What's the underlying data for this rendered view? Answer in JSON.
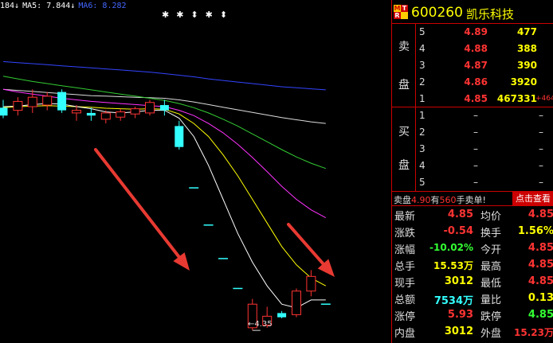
{
  "ma_legend": [
    {
      "text": "184↓",
      "color": "#ffffff"
    },
    {
      "text": "MA5: 7.844↓",
      "color": "#ffffff"
    },
    {
      "text": "MA6: 8.282",
      "color": "#4466ff"
    }
  ],
  "markers": "✱✱⬍✱⬍",
  "low_label": "←4.35",
  "colors": {
    "up": "#ff3333",
    "down": "#33ffff",
    "ma5": "#ffffff",
    "ma10": "#ffff00",
    "ma20": "#ff33ff",
    "ma30": "#33cc33",
    "ma60": "#dddddd",
    "ma120": "#3344ff",
    "border": "#cc0000",
    "highlight": "#ffff00"
  },
  "header": {
    "mtr": [
      "M",
      "T",
      "R"
    ],
    "code": "600260",
    "name": "凯乐科技"
  },
  "sell_side": "卖盘",
  "sell": [
    {
      "level": "5",
      "price": "4.89",
      "vol": "477",
      "chg": ""
    },
    {
      "level": "4",
      "price": "4.88",
      "vol": "388",
      "chg": ""
    },
    {
      "level": "3",
      "price": "4.87",
      "vol": "390",
      "chg": ""
    },
    {
      "level": "2",
      "price": "4.86",
      "vol": "3920",
      "chg": ""
    },
    {
      "level": "1",
      "price": "4.85",
      "vol": "467331",
      "chg": "+464319"
    }
  ],
  "buy_side": "买盘",
  "buy": [
    {
      "level": "1",
      "price": "–",
      "vol": "–"
    },
    {
      "level": "2",
      "price": "–",
      "vol": "–"
    },
    {
      "level": "3",
      "price": "–",
      "vol": "–"
    },
    {
      "level": "4",
      "price": "–",
      "vol": "–"
    },
    {
      "level": "5",
      "price": "–",
      "vol": "–"
    }
  ],
  "tradebar": {
    "prefix": "卖盘",
    "price": "4.90",
    "mid": "有",
    "qty": "560",
    "suffix": "手卖单!",
    "button": "点击查看"
  },
  "stats": [
    {
      "label": "最新",
      "value": "4.85",
      "color": "#ff3333"
    },
    {
      "label": "均价",
      "value": "4.85",
      "color": "#ff3333"
    },
    {
      "label": "涨跌",
      "value": "-0.54",
      "color": "#ff3333"
    },
    {
      "label": "换手",
      "value": "1.56%",
      "color": "#ffff00"
    },
    {
      "label": "涨幅",
      "value": "-10.02%",
      "color": "#33ff33"
    },
    {
      "label": "今开",
      "value": "4.85",
      "color": "#ff3333"
    },
    {
      "label": "总手",
      "value": "15.53万",
      "color": "#ffff00"
    },
    {
      "label": "最高",
      "value": "4.85",
      "color": "#ff3333"
    },
    {
      "label": "现手",
      "value": "3012",
      "color": "#ffff00"
    },
    {
      "label": "最低",
      "value": "4.85",
      "color": "#ff3333"
    },
    {
      "label": "总额",
      "value": "7534万",
      "color": "#33ffff"
    },
    {
      "label": "量比",
      "value": "0.13",
      "color": "#ffff00"
    },
    {
      "label": "涨停",
      "value": "5.93",
      "color": "#ff3333"
    },
    {
      "label": "跌停",
      "value": "4.85",
      "color": "#33ff33"
    },
    {
      "label": "内盘",
      "value": "3012",
      "color": "#ffff00"
    },
    {
      "label": "外盘",
      "value": "15.23万",
      "color": "#ff3333"
    }
  ],
  "chart_data": {
    "type": "candlestick",
    "price_range": [
      4.2,
      10.2
    ],
    "candles": [
      {
        "o": 8.6,
        "h": 8.75,
        "l": 8.4,
        "c": 8.45,
        "dir": "down"
      },
      {
        "o": 8.55,
        "h": 8.8,
        "l": 8.45,
        "c": 8.72,
        "dir": "up"
      },
      {
        "o": 8.62,
        "h": 8.95,
        "l": 8.5,
        "c": 8.8,
        "dir": "up"
      },
      {
        "o": 8.65,
        "h": 8.9,
        "l": 8.55,
        "c": 8.82,
        "dir": "up"
      },
      {
        "o": 8.9,
        "h": 8.95,
        "l": 8.5,
        "c": 8.55,
        "dir": "down"
      },
      {
        "o": 8.55,
        "h": 8.65,
        "l": 8.35,
        "c": 8.5,
        "dir": "up"
      },
      {
        "o": 8.5,
        "h": 8.6,
        "l": 8.35,
        "c": 8.45,
        "dir": "down"
      },
      {
        "o": 8.38,
        "h": 8.55,
        "l": 8.3,
        "c": 8.5,
        "dir": "up"
      },
      {
        "o": 8.42,
        "h": 8.58,
        "l": 8.35,
        "c": 8.52,
        "dir": "up"
      },
      {
        "o": 8.48,
        "h": 8.62,
        "l": 8.4,
        "c": 8.58,
        "dir": "up"
      },
      {
        "o": 8.5,
        "h": 8.75,
        "l": 8.45,
        "c": 8.7,
        "dir": "up"
      },
      {
        "o": 8.65,
        "h": 8.75,
        "l": 8.45,
        "c": 8.55,
        "dir": "down"
      },
      {
        "o": 8.25,
        "h": 8.35,
        "l": 7.8,
        "c": 7.85,
        "dir": "down"
      },
      {
        "o": 7.07,
        "h": 7.07,
        "l": 7.07,
        "c": 7.07,
        "dir": "down"
      },
      {
        "o": 6.36,
        "h": 6.36,
        "l": 6.36,
        "c": 6.36,
        "dir": "down"
      },
      {
        "o": 5.72,
        "h": 5.72,
        "l": 5.72,
        "c": 5.72,
        "dir": "down"
      },
      {
        "o": 5.15,
        "h": 5.15,
        "l": 5.15,
        "c": 5.15,
        "dir": "down"
      },
      {
        "o": 4.4,
        "h": 4.95,
        "l": 4.35,
        "c": 4.85,
        "dir": "up"
      },
      {
        "o": 4.45,
        "h": 4.8,
        "l": 4.4,
        "c": 4.62,
        "dir": "up"
      },
      {
        "o": 4.68,
        "h": 4.72,
        "l": 4.58,
        "c": 4.6,
        "dir": "down"
      },
      {
        "o": 4.65,
        "h": 5.15,
        "l": 4.6,
        "c": 5.1,
        "dir": "up"
      },
      {
        "o": 5.1,
        "h": 5.5,
        "l": 5.0,
        "c": 5.38,
        "dir": "up"
      },
      {
        "o": 4.85,
        "h": 4.85,
        "l": 4.85,
        "c": 4.85,
        "dir": "down"
      }
    ],
    "ma": {
      "ma5": [
        8.62,
        8.63,
        8.66,
        8.68,
        8.67,
        8.62,
        8.58,
        8.52,
        8.5,
        8.52,
        8.55,
        8.55,
        8.4,
        8.05,
        7.5,
        6.85,
        6.2,
        5.65,
        5.2,
        4.85,
        4.78,
        4.93,
        4.93
      ],
      "ma10": [
        8.6,
        8.62,
        8.63,
        8.64,
        8.63,
        8.62,
        8.61,
        8.59,
        8.58,
        8.57,
        8.58,
        8.57,
        8.48,
        8.3,
        8.05,
        7.7,
        7.3,
        6.85,
        6.4,
        5.95,
        5.6,
        5.35,
        5.2
      ],
      "ma20": [
        8.95,
        8.9,
        8.86,
        8.82,
        8.78,
        8.75,
        8.72,
        8.7,
        8.68,
        8.66,
        8.64,
        8.62,
        8.55,
        8.45,
        8.3,
        8.12,
        7.9,
        7.65,
        7.38,
        7.1,
        6.85,
        6.65,
        6.5
      ],
      "ma30": [
        9.2,
        9.15,
        9.1,
        9.06,
        9.02,
        8.98,
        8.94,
        8.9,
        8.86,
        8.82,
        8.78,
        8.74,
        8.68,
        8.6,
        8.5,
        8.38,
        8.25,
        8.1,
        7.95,
        7.8,
        7.66,
        7.54,
        7.44
      ],
      "ma60": [
        8.95,
        8.93,
        8.91,
        8.89,
        8.87,
        8.85,
        8.83,
        8.82,
        8.81,
        8.8,
        8.79,
        8.78,
        8.75,
        8.71,
        8.66,
        8.61,
        8.56,
        8.51,
        8.46,
        8.41,
        8.37,
        8.33,
        8.3
      ],
      "ma120": [
        9.48,
        9.46,
        9.44,
        9.42,
        9.4,
        9.38,
        9.36,
        9.34,
        9.32,
        9.3,
        9.28,
        9.25,
        9.22,
        9.19,
        9.15,
        9.12,
        9.09,
        9.06,
        9.03,
        9.0,
        8.98,
        8.96,
        8.94
      ]
    },
    "low_marker_value": 4.35
  }
}
